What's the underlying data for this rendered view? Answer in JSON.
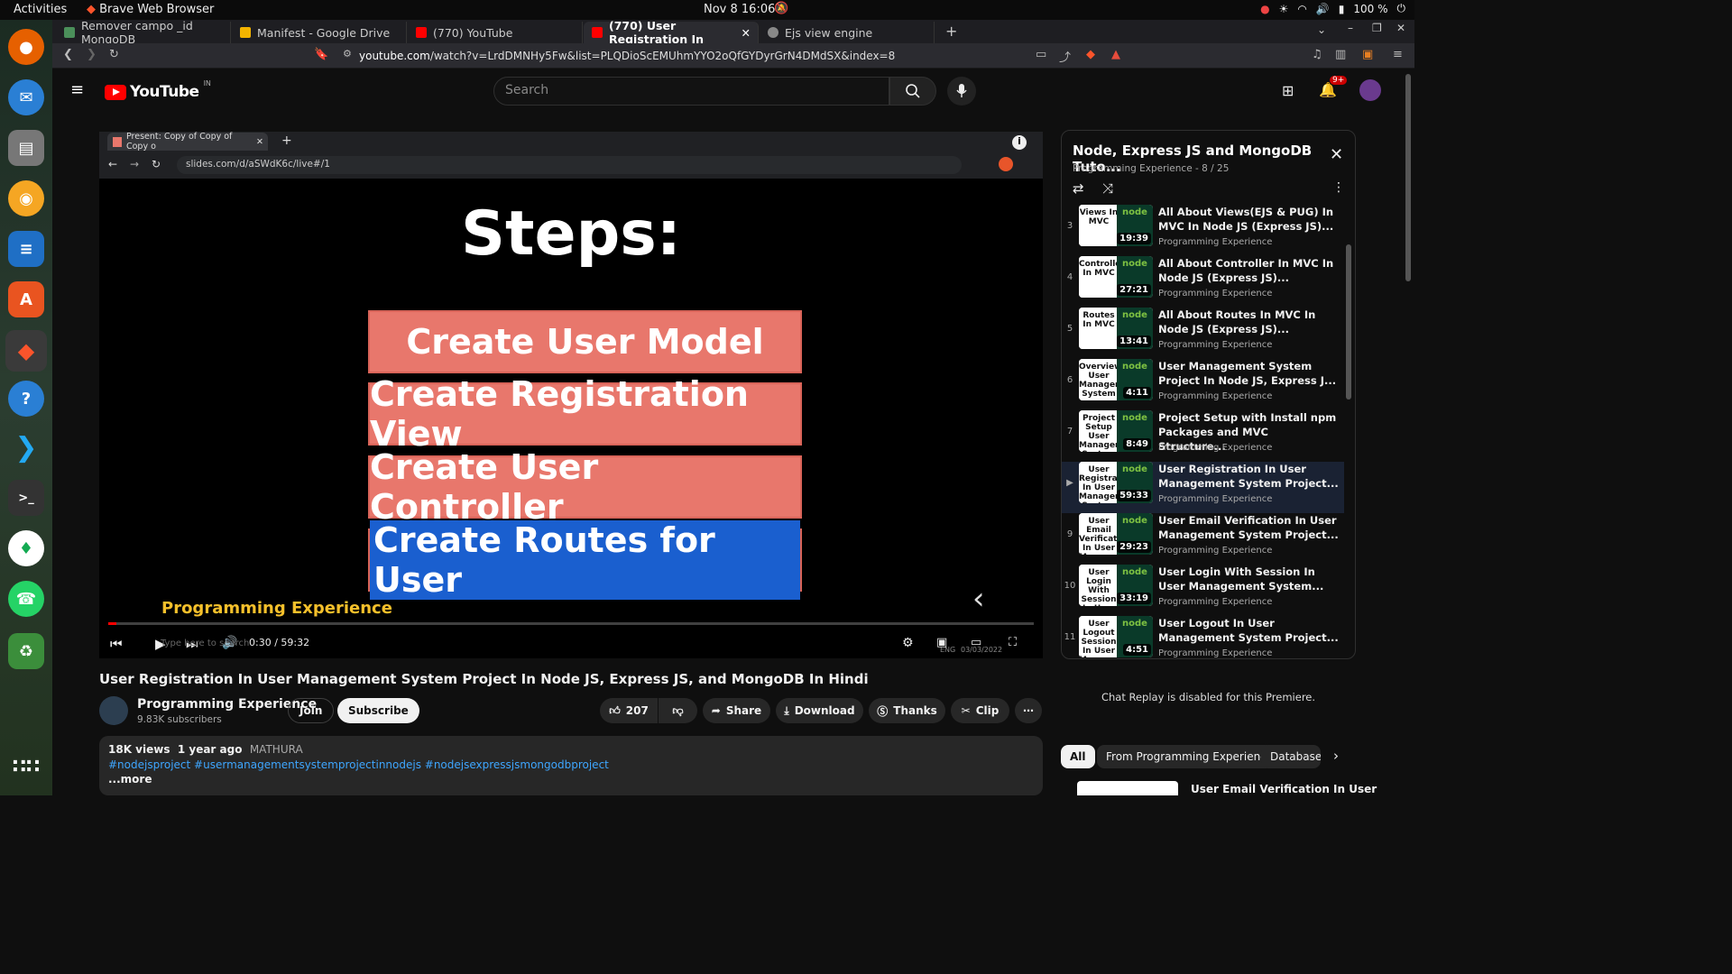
{
  "system_bar": {
    "activities": "Activities",
    "window_title": "Brave Web Browser",
    "clock": "Nov 8  16:06",
    "battery": "100 %"
  },
  "browser": {
    "tabs": [
      {
        "label": "Remover campo _id MongoDB",
        "color": "#4b8f5a"
      },
      {
        "label": "Manifest - Google Drive",
        "color": "#f4b400"
      },
      {
        "label": "(770) YouTube",
        "color": "#ff0000"
      },
      {
        "label": "(770) User Registration In",
        "color": "#ff0000"
      },
      {
        "label": "Ejs view engine",
        "color": "#888888"
      }
    ],
    "url_host": "youtube.com",
    "url_path": "/watch?v=LrdDMNHy5Fw&list=PLQDioScEMUhmYYO2oQfGYDyrGrN4DMdSX&index=8"
  },
  "youtube": {
    "logo_text": "YouTube",
    "logo_region": "IN",
    "search_placeholder": "Search",
    "notif_badge": "9+"
  },
  "inner_browser": {
    "tab_label": "Present: Copy of Copy of Copy o",
    "url": "slides.com/d/aSWdK6c/live#/1"
  },
  "slide": {
    "title": "Steps:",
    "steps": [
      "Create User Model",
      "Create Registration View",
      "Create User Controller",
      "Create Routes for User"
    ],
    "brand": "Programming Experience",
    "accent": "#e8776c"
  },
  "player": {
    "time": "0:30 / 59:32",
    "progress_fraction": 0.0084,
    "overlay_search": "Type here to search",
    "overlay_date": "03/03/2022",
    "overlay_lang": "ENG"
  },
  "video": {
    "title": "User Registration In User Management System Project In Node JS, Express JS, and MongoDB In Hindi",
    "channel": "Programming Experience",
    "subscribers": "9.83K subscribers",
    "join": "Join",
    "subscribe": "Subscribe",
    "likes": "207",
    "share": "Share",
    "download": "Download",
    "thanks": "Thanks",
    "clip": "Clip",
    "views": "18K views",
    "ago": "1 year ago",
    "location": "MATHURA",
    "tags": "#nodejsproject #usermanagementsystemprojectinnodejs #nodejsexpressjsmongodbproject",
    "more": "...more"
  },
  "playlist": {
    "title": "Node, Express JS and MongoDB Tuto...",
    "subtitle": "Programming Experience - 8 / 25",
    "items": [
      {
        "num": "3",
        "thumb": "Views In MVC",
        "dur": "19:39",
        "title": "All About Views(EJS & PUG) In MVC In Node JS (Express JS)...",
        "channel": "Programming Experience"
      },
      {
        "num": "4",
        "thumb": "Controller In MVC",
        "dur": "27:21",
        "title": "All About Controller In MVC In Node JS (Express JS)...",
        "channel": "Programming Experience"
      },
      {
        "num": "5",
        "thumb": "Routes In MVC",
        "dur": "13:41",
        "title": "All About Routes In MVC In Node JS (Express JS)...",
        "channel": "Programming Experience"
      },
      {
        "num": "6",
        "thumb": "Overview User Management System",
        "dur": "4:11",
        "title": "User Management System Project In Node JS, Express J...",
        "channel": "Programming Experience"
      },
      {
        "num": "7",
        "thumb": "Project Setup User Management System",
        "dur": "8:49",
        "title": "Project Setup with Install npm Packages and MVC Structure...",
        "channel": "Programming Experience"
      },
      {
        "num": "▶",
        "thumb": "User Registration In User Management System",
        "dur": "59:33",
        "title": "User Registration In User Management System Project...",
        "channel": "Programming Experience"
      },
      {
        "num": "9",
        "thumb": "User Email Verification In User Management System",
        "dur": "29:23",
        "title": "User Email Verification In User Management System Project...",
        "channel": "Programming Experience"
      },
      {
        "num": "10",
        "thumb": "User Login With Session In User Management System",
        "dur": "33:19",
        "title": "User Login With Session In User Management System...",
        "channel": "Programming Experience"
      },
      {
        "num": "11",
        "thumb": "User Logout Session In User Management System",
        "dur": "4:51",
        "title": "User Logout In User Management System Project...",
        "channel": "Programming Experience"
      }
    ]
  },
  "sidebar": {
    "chat_replay": "Chat Replay is disabled for this Premiere.",
    "chips": [
      "All",
      "From Programming Experience",
      "Database"
    ],
    "next_title": "User Email Verification In User"
  }
}
